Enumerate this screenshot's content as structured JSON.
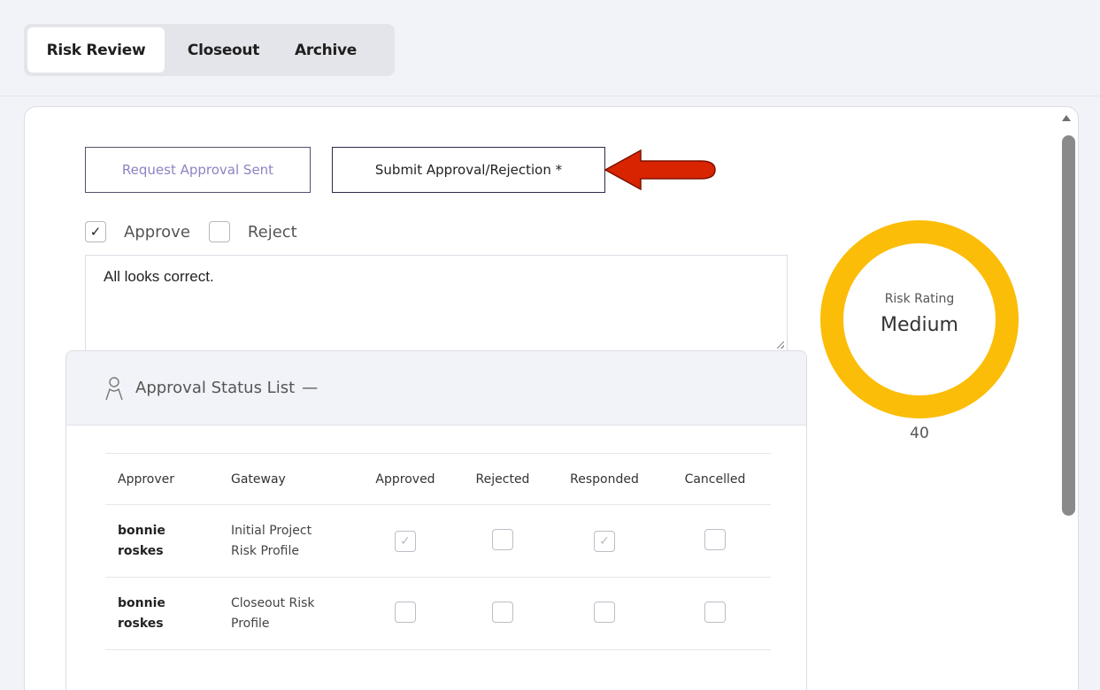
{
  "tabs": [
    {
      "label": "Risk Review",
      "active": true
    },
    {
      "label": "Closeout",
      "active": false
    },
    {
      "label": "Archive",
      "active": false
    }
  ],
  "actions": {
    "request_label": "Request Approval Sent",
    "submit_label": "Submit Approval/Rejection *"
  },
  "decision": {
    "approve_label": "Approve",
    "approve_checked": true,
    "reject_label": "Reject",
    "reject_checked": false,
    "comment_value": "All looks correct."
  },
  "approval_panel": {
    "title": "Approval Status List",
    "collapse_symbol": "—",
    "icon": "user-icon",
    "columns": [
      "Approver",
      "Gateway",
      "Approved",
      "Rejected",
      "Responded",
      "Cancelled"
    ],
    "rows": [
      {
        "approver_first": "bonnie",
        "approver_last": "roskes",
        "gateway_1": "Initial Project",
        "gateway_2": "Risk Profile",
        "approved": true,
        "rejected": false,
        "responded": true,
        "cancelled": false
      },
      {
        "approver_first": "bonnie",
        "approver_last": "roskes",
        "gateway_1": "Closeout Risk",
        "gateway_2": "Profile",
        "approved": false,
        "rejected": false,
        "responded": false,
        "cancelled": false
      }
    ]
  },
  "risk_rating": {
    "label": "Risk Rating",
    "value": "Medium",
    "score": "40",
    "ring_color": "#fbbd08"
  },
  "colors": {
    "annotation_arrow": "#d82400"
  }
}
